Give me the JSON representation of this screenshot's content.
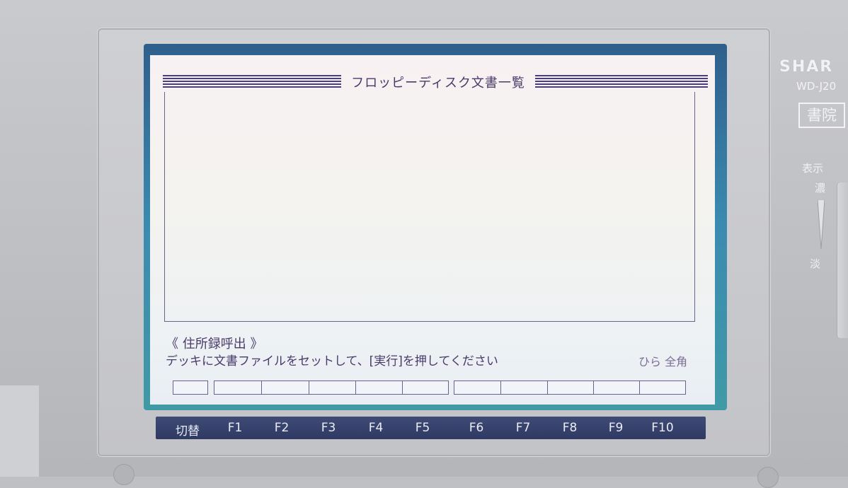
{
  "screen": {
    "title": "フロッピーディスク文書一覧",
    "mode_label": "《 住所録呼出 》",
    "message": "デッキに文書ファイルをセットして、[実行]を押してください",
    "status": "ひら 全角"
  },
  "keys": [
    "切替",
    "F1",
    "F2",
    "F3",
    "F4",
    "F5",
    "F6",
    "F7",
    "F8",
    "F9",
    "F10"
  ],
  "device": {
    "brand": "SHAR",
    "model": "WD-J20",
    "logo": "書院",
    "display_label": "表示",
    "dark_label": "濃",
    "light_label": "淡"
  },
  "colors": {
    "lcd_text": "#4a3a6a",
    "key_bar": "#34406b"
  }
}
